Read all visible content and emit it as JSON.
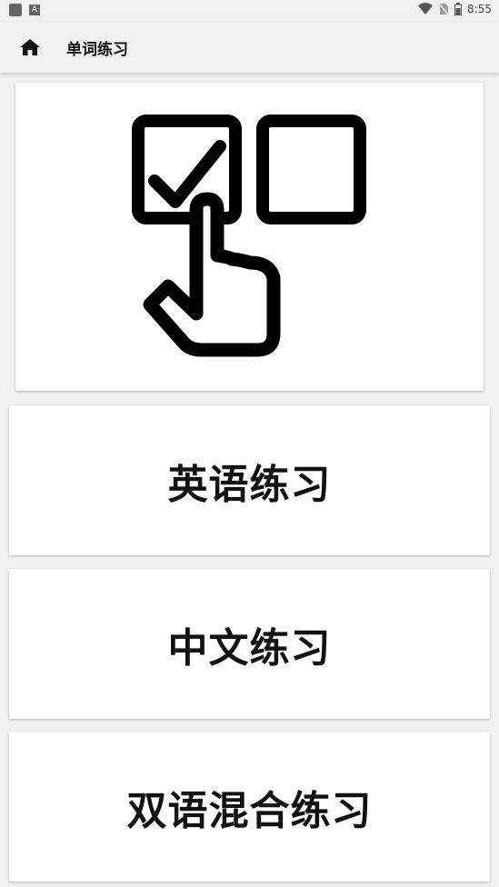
{
  "status_bar": {
    "time": "8:55",
    "icons": [
      "app-icon",
      "keyboard-icon",
      "wifi-icon",
      "no-sim-icon",
      "battery-icon"
    ]
  },
  "app_bar": {
    "home_icon": "home-icon",
    "title": "单词练习"
  },
  "hero": {
    "illustration": "checkbox-select-hand-icon"
  },
  "buttons": [
    {
      "label": "英语练习"
    },
    {
      "label": "中文练习"
    },
    {
      "label": "双语混合练习"
    }
  ]
}
